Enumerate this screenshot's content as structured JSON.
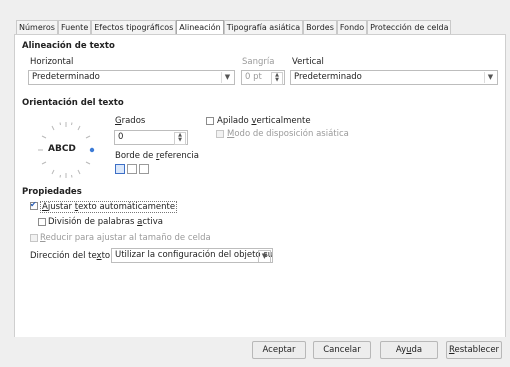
{
  "tabs": [
    "Números",
    "Fuente",
    "Efectos tipográficos",
    "Alineación",
    "Tipografía asiática",
    "Bordes",
    "Fondo",
    "Protección de celda"
  ],
  "alignment": {
    "title": "Alineación de texto",
    "horizontal_label": "Horizontal",
    "horizontal_value": "Predeterminado",
    "indent_label": "Sangría",
    "indent_value": "0 pt",
    "vertical_label": "Vertical",
    "vertical_value": "Predeterminado"
  },
  "orientation": {
    "title": "Orientación del texto",
    "dial_text": "ABCD",
    "degrees_label": "Grados",
    "degrees_value": "0",
    "reference_label": "Borde de referencia",
    "stacked_label": "Apilado verticalmente",
    "asian_label": "Modo de disposición asiática"
  },
  "properties": {
    "title": "Propiedades",
    "wrap_label": "Ajustar texto automáticamente",
    "wrap_checked": true,
    "hyphen_label": "División de palabras activa",
    "hyphen_checked": false,
    "shrink_label": "Reducir para ajustar al tamaño de celda",
    "direction_label": "Dirección del texto",
    "direction_value": "Utilizar la configuración del objeto superior"
  },
  "buttons": {
    "ok": "Aceptar",
    "cancel": "Cancelar",
    "help": "Ayuda",
    "reset": "Restablecer"
  }
}
